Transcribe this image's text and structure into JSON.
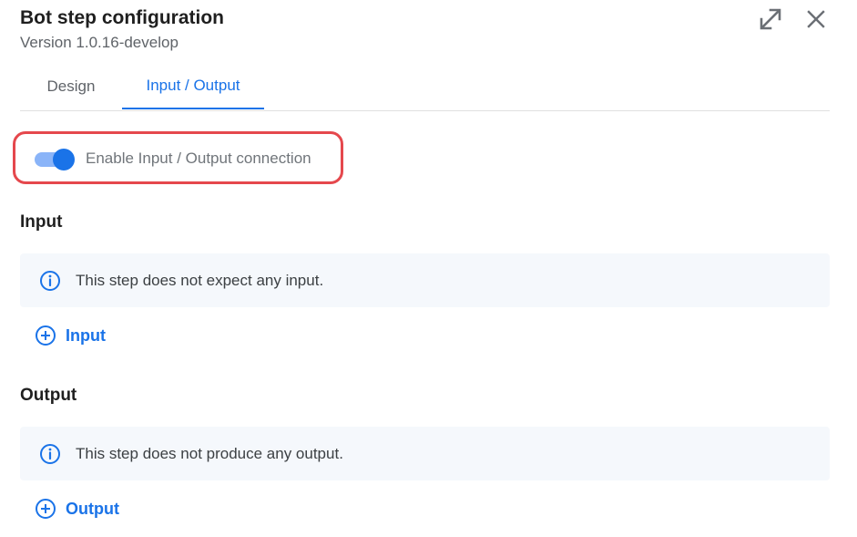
{
  "header": {
    "title": "Bot step configuration",
    "version": "Version 1.0.16-develop",
    "expand_icon": "expand-diagonal-icon",
    "close_icon": "close-icon"
  },
  "tabs": [
    {
      "label": "Design",
      "selected": false
    },
    {
      "label": "Input / Output",
      "selected": true
    }
  ],
  "toggle": {
    "label": "Enable Input / Output connection",
    "enabled": true
  },
  "input_section": {
    "title": "Input",
    "info_text": "This step does not expect any input.",
    "add_label": "Input"
  },
  "output_section": {
    "title": "Output",
    "info_text": "This step does not produce any output.",
    "add_label": "Output"
  },
  "colors": {
    "accent": "#1a73e8",
    "highlight": "#e5484d",
    "info_bg": "#f5f8fc"
  }
}
